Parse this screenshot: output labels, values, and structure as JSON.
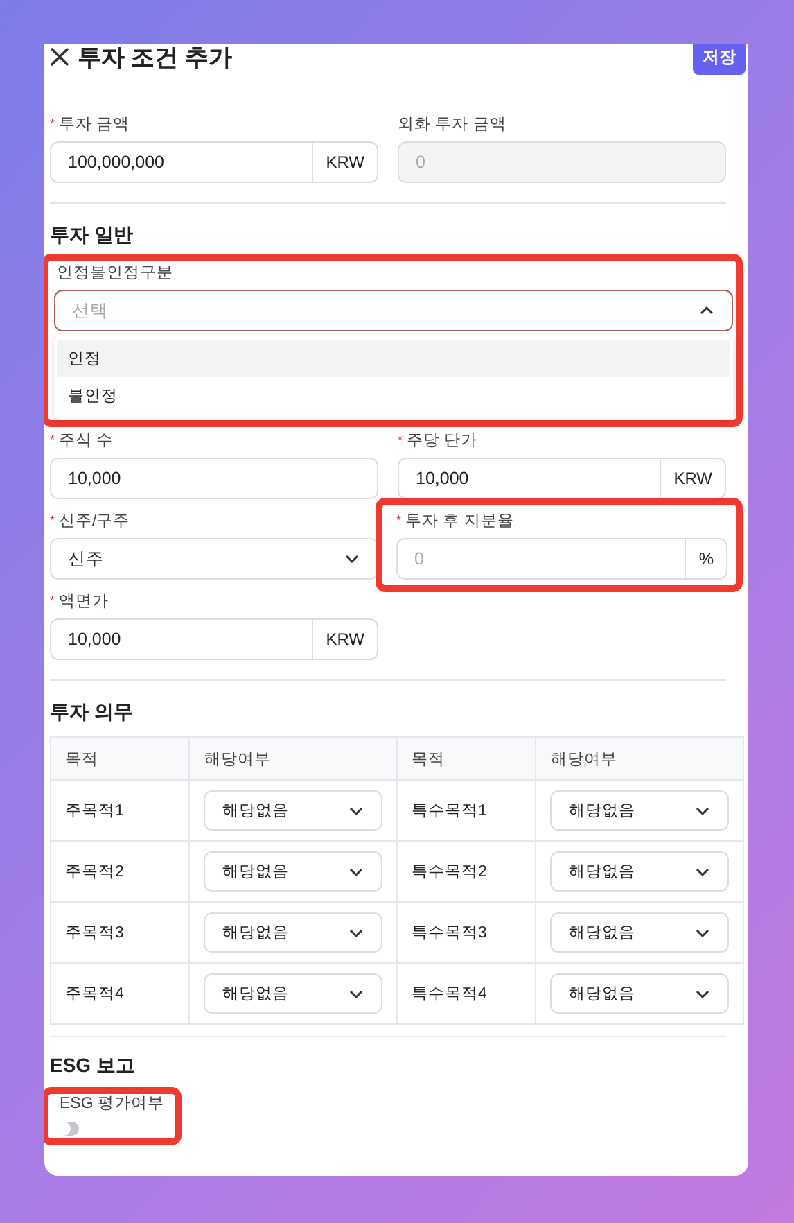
{
  "header": {
    "title": "투자 조건 추가",
    "save_button": "저장"
  },
  "amount_fields": [
    {
      "kind": "input",
      "label": "투자 금액",
      "required_mark": "*",
      "value": "100,000,000",
      "unit": "KRW",
      "disabled": false,
      "annotated": false
    },
    {
      "kind": "input",
      "label": "외화 투자 금액",
      "placeholder": "0",
      "disabled": true,
      "annotated": false
    }
  ],
  "general": {
    "title": "투자 일반",
    "recognition": {
      "label": "인정불인정구분",
      "placeholder": "선택",
      "expanded": true,
      "annotated": true,
      "options": [
        {
          "label": "인정",
          "highlighted": true
        },
        {
          "label": "불인정",
          "highlighted": false
        }
      ]
    },
    "fields": [
      {
        "kind": "input",
        "label": "주식 수",
        "required_mark": "*",
        "value": "10,000",
        "disabled": false,
        "annotated": false
      },
      {
        "kind": "input",
        "label": "주당 단가",
        "required_mark": "*",
        "value": "10,000",
        "unit": "KRW",
        "disabled": false,
        "annotated": false
      },
      {
        "kind": "select",
        "label": "신주/구주",
        "required_mark": "*",
        "value": "신주",
        "disabled": false,
        "annotated": false
      },
      {
        "kind": "input",
        "label": "투자 후 지분율",
        "required_mark": "*",
        "placeholder": "0",
        "unit": "%",
        "disabled": false,
        "annotated": true
      },
      {
        "kind": "input",
        "label": "액면가",
        "required_mark": "*",
        "value": "10,000",
        "unit": "KRW",
        "disabled": false,
        "annotated": false
      }
    ]
  },
  "obligations": {
    "title": "투자 의무",
    "columns": [
      "목적",
      "해당여부",
      "목적",
      "해당여부"
    ],
    "rows": [
      {
        "purpose_1": "주목적1",
        "value_1": "해당없음",
        "purpose_2": "특수목적1",
        "value_2": "해당없음"
      },
      {
        "purpose_1": "주목적2",
        "value_1": "해당없음",
        "purpose_2": "특수목적2",
        "value_2": "해당없음"
      },
      {
        "purpose_1": "주목적3",
        "value_1": "해당없음",
        "purpose_2": "특수목적3",
        "value_2": "해당없음"
      },
      {
        "purpose_1": "주목적4",
        "value_1": "해당없음",
        "purpose_2": "특수목적4",
        "value_2": "해당없음"
      }
    ]
  },
  "esg": {
    "title": "ESG 보고",
    "toggle": {
      "label": "ESG 평가여부",
      "on": false,
      "annotated": true
    }
  }
}
